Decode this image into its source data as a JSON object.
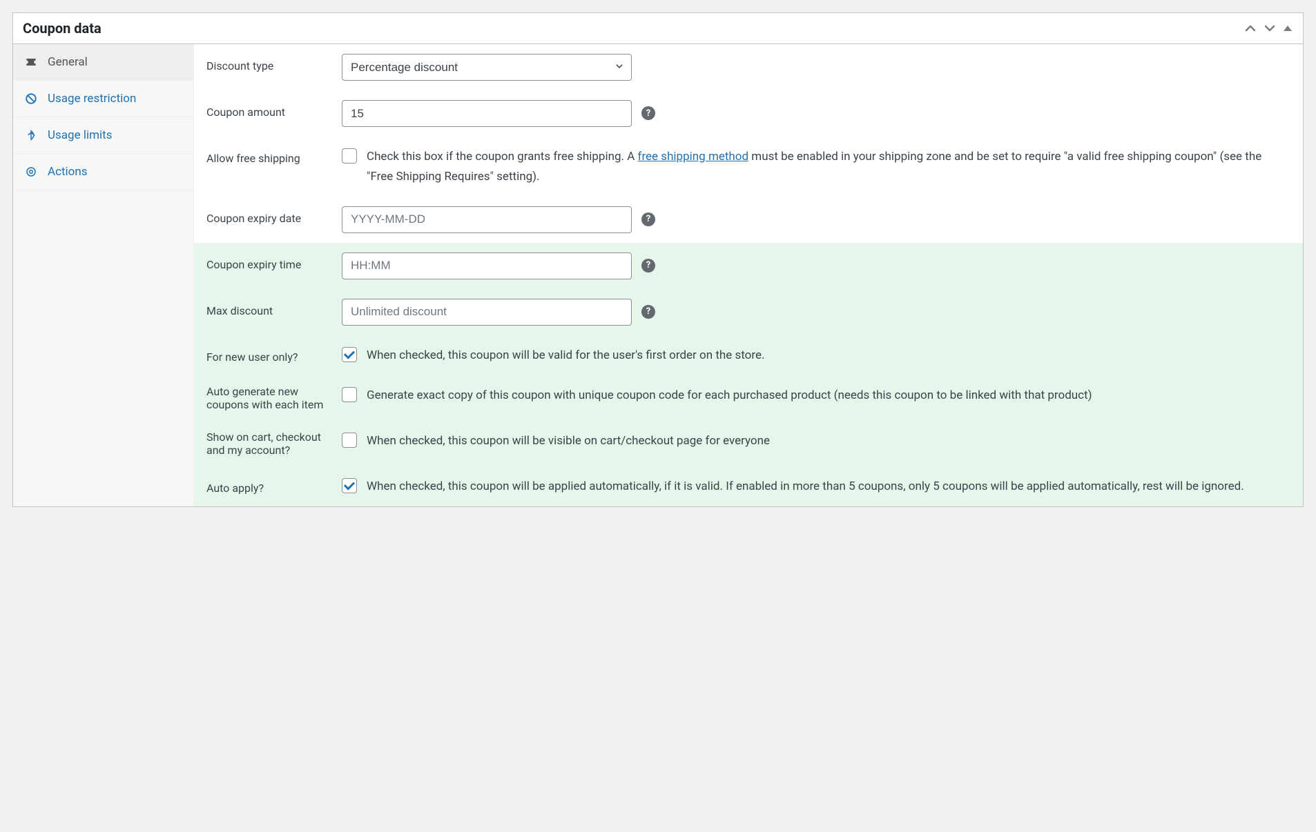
{
  "header": {
    "title": "Coupon data"
  },
  "sidebar": {
    "items": [
      {
        "id": "general",
        "label": "General",
        "icon": "ticket"
      },
      {
        "id": "usage-restriction",
        "label": "Usage restriction",
        "icon": "ban"
      },
      {
        "id": "usage-limits",
        "label": "Usage limits",
        "icon": "compress"
      },
      {
        "id": "actions",
        "label": "Actions",
        "icon": "gear"
      }
    ]
  },
  "form": {
    "discount_type": {
      "label": "Discount type",
      "selected": "Percentage discount"
    },
    "coupon_amount": {
      "label": "Coupon amount",
      "value": "15"
    },
    "allow_free_shipping": {
      "label": "Allow free shipping",
      "checked": false,
      "desc_pre": "Check this box if the coupon grants free shipping. A ",
      "link_text": "free shipping method",
      "desc_post": " must be enabled in your shipping zone and be set to require \"a valid free shipping coupon\" (see the \"Free Shipping Requires\" setting)."
    },
    "expiry_date": {
      "label": "Coupon expiry date",
      "placeholder": "YYYY-MM-DD"
    },
    "expiry_time": {
      "label": "Coupon expiry time",
      "placeholder": "HH:MM"
    },
    "max_discount": {
      "label": "Max discount",
      "placeholder": "Unlimited discount"
    },
    "new_user_only": {
      "label": "For new user only?",
      "checked": true,
      "desc": "When checked, this coupon will be valid for the user's first order on the store."
    },
    "auto_generate": {
      "label": "Auto generate new coupons with each item",
      "checked": false,
      "desc": "Generate exact copy of this coupon with unique coupon code for each purchased product (needs this coupon to be linked with that product)"
    },
    "show_on_cart": {
      "label": "Show on cart, checkout and my account?",
      "checked": false,
      "desc": "When checked, this coupon will be visible on cart/checkout page for everyone"
    },
    "auto_apply": {
      "label": "Auto apply?",
      "checked": true,
      "desc": "When checked, this coupon will be applied automatically, if it is valid. If enabled in more than 5 coupons, only 5 coupons will be applied automatically, rest will be ignored."
    }
  }
}
